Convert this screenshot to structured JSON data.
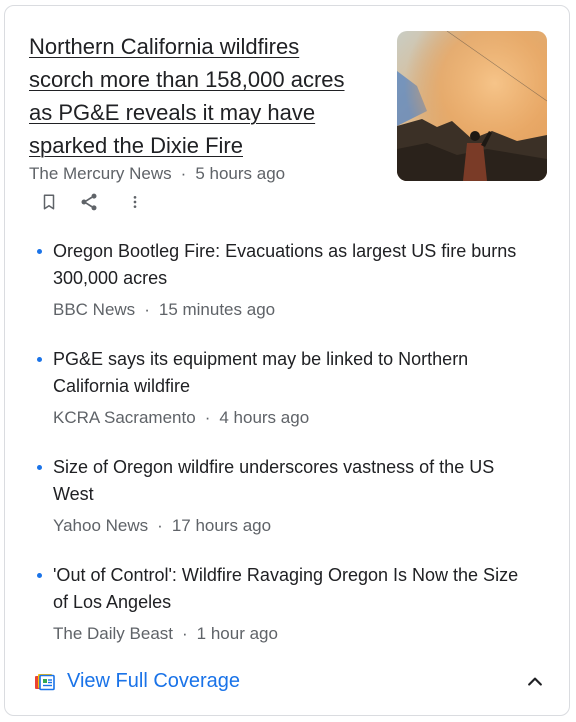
{
  "top_story": {
    "headline": "Northern California wildfires scorch more than 158,000 acres as PG&E reveals it may have sparked the Dixie Fire",
    "source": "The Mercury News",
    "separator": "·",
    "time": "5 hours ago"
  },
  "actions": {
    "bookmark_icon": "bookmark-icon",
    "share_icon": "share-icon",
    "more_icon": "more-vert-icon"
  },
  "stories": [
    {
      "title": "Oregon Bootleg Fire: Evacuations as largest US fire burns 300,000 acres",
      "source": "BBC News",
      "time": "15 minutes ago"
    },
    {
      "title": "PG&E says its equipment may be linked to Northern California wildfire",
      "source": "KCRA Sacramento",
      "time": "4 hours ago"
    },
    {
      "title": "Size of Oregon wildfire underscores vastness of the US West",
      "source": "Yahoo News",
      "time": "17 hours ago"
    },
    {
      "title": "'Out of Control': Wildfire Ravaging Oregon Is Now the Size of Los Angeles",
      "source": "The Daily Beast",
      "time": "1 hour ago"
    }
  ],
  "footer": {
    "label": "View Full Coverage",
    "coverage_icon": "full-coverage-icon",
    "collapse_icon": "chevron-up-icon"
  },
  "colors": {
    "link_blue": "#1a73e8",
    "meta_gray": "#5f6368",
    "text": "#202124"
  }
}
